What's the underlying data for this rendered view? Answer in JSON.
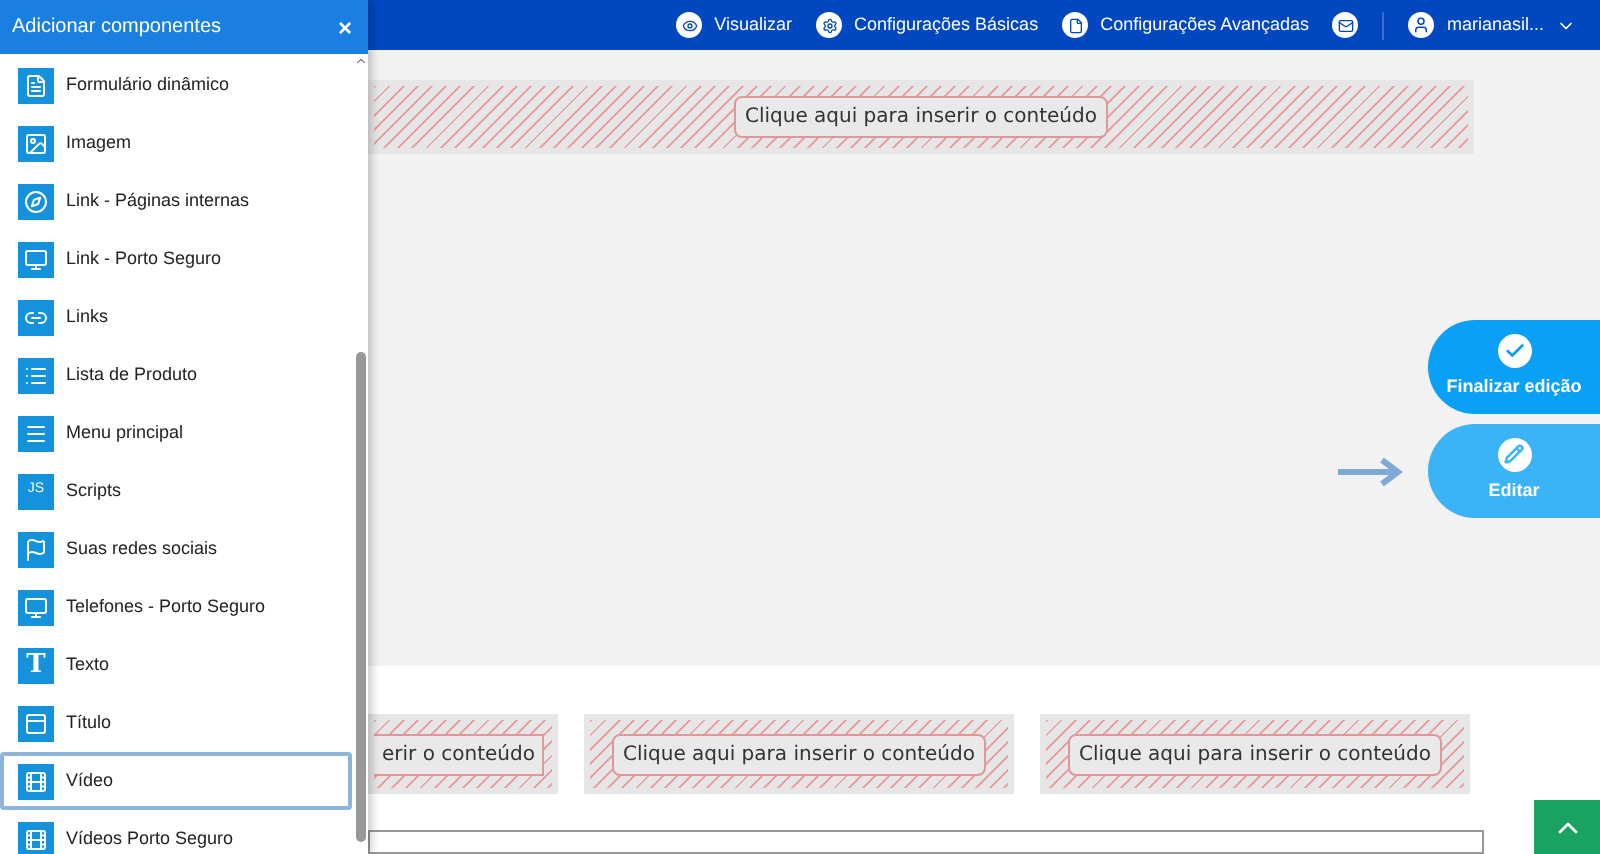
{
  "panel": {
    "title": "Adicionar componentes",
    "close": "×",
    "items": [
      {
        "label": "Formulário dinâmico",
        "selected": false
      },
      {
        "label": "Imagem",
        "selected": false
      },
      {
        "label": "Link - Páginas internas",
        "selected": false
      },
      {
        "label": "Link - Porto Seguro",
        "selected": false
      },
      {
        "label": "Links",
        "selected": false
      },
      {
        "label": "Lista de Produto",
        "selected": false
      },
      {
        "label": "Menu principal",
        "selected": false
      },
      {
        "label": "Scripts",
        "selected": false,
        "icon_text": "JS"
      },
      {
        "label": "Suas redes sociais",
        "selected": false
      },
      {
        "label": "Telefones - Porto Seguro",
        "selected": false
      },
      {
        "label": "Texto",
        "selected": false,
        "icon_text": "T"
      },
      {
        "label": "Título",
        "selected": false
      },
      {
        "label": "Vídeo",
        "selected": true
      },
      {
        "label": "Vídeos Porto Seguro",
        "selected": false
      }
    ]
  },
  "header": {
    "items": [
      "Visualizar",
      "Configurações Básicas",
      "Configurações Avançadas"
    ],
    "user": "marianasil..."
  },
  "top_placeholder": "Clique aqui para inserir o conteúdo",
  "bottom_placeholders": [
    "erir o conteúdo",
    "Clique aqui para inserir o conteúdo",
    "Clique aqui para inserir o conteúdo"
  ],
  "actions": [
    {
      "label": "Finalizar edição",
      "kind": "finish"
    },
    {
      "label": "Editar",
      "kind": "edit"
    }
  ]
}
